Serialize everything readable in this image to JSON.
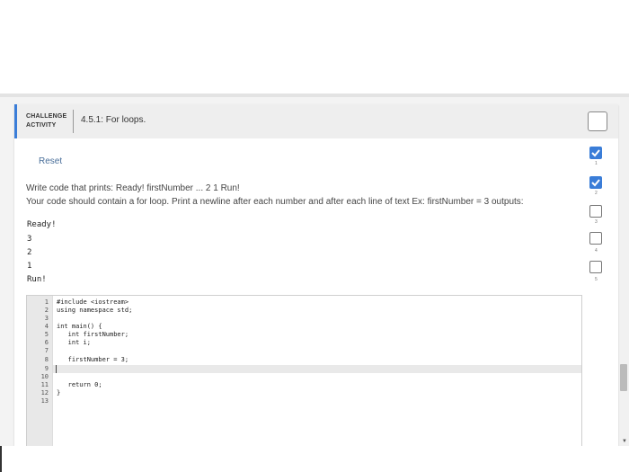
{
  "activity": {
    "tag_line1": "CHALLENGE",
    "tag_line2": "ACTIVITY",
    "title": "4.5.1: For loops."
  },
  "reset_label": "Reset",
  "instructions": {
    "line1": "Write code that prints: Ready! firstNumber ... 2 1 Run!",
    "line2": "Your code should contain a for loop. Print a newline after each number and after each line of text Ex: firstNumber = 3 outputs:"
  },
  "example_output": [
    "Ready!",
    "3",
    "2",
    "1",
    "Run!"
  ],
  "editor": {
    "line_numbers": [
      "1",
      "2",
      "3",
      "4",
      "5",
      "6",
      "7",
      "8",
      "9",
      "10",
      "11",
      "12",
      "13"
    ],
    "lines": [
      "#include <iostream>",
      "using namespace std;",
      "",
      "int main() {",
      "   int firstNumber;",
      "   int i;",
      "",
      "   firstNumber = 3;",
      "",
      "",
      "   return 0;",
      "}",
      ""
    ]
  },
  "progress": {
    "levels": [
      "1",
      "2",
      "3",
      "4",
      "5"
    ],
    "completed": [
      true,
      true,
      false,
      false,
      false
    ]
  },
  "colors": {
    "accent": "#3a7dd8",
    "link": "#4a6f9a"
  }
}
